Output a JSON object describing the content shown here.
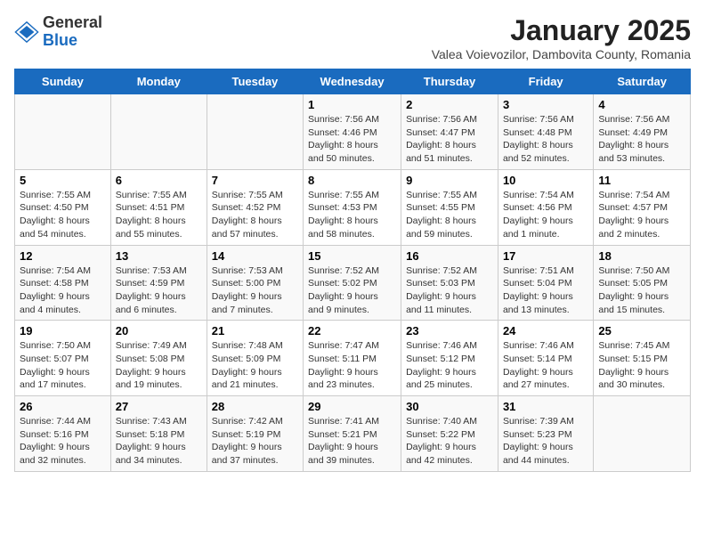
{
  "logo": {
    "general": "General",
    "blue": "Blue"
  },
  "header": {
    "title": "January 2025",
    "subtitle": "Valea Voievozilor, Dambovita County, Romania"
  },
  "weekdays": [
    "Sunday",
    "Monday",
    "Tuesday",
    "Wednesday",
    "Thursday",
    "Friday",
    "Saturday"
  ],
  "weeks": [
    [
      {
        "day": "",
        "info": ""
      },
      {
        "day": "",
        "info": ""
      },
      {
        "day": "",
        "info": ""
      },
      {
        "day": "1",
        "info": "Sunrise: 7:56 AM\nSunset: 4:46 PM\nDaylight: 8 hours\nand 50 minutes."
      },
      {
        "day": "2",
        "info": "Sunrise: 7:56 AM\nSunset: 4:47 PM\nDaylight: 8 hours\nand 51 minutes."
      },
      {
        "day": "3",
        "info": "Sunrise: 7:56 AM\nSunset: 4:48 PM\nDaylight: 8 hours\nand 52 minutes."
      },
      {
        "day": "4",
        "info": "Sunrise: 7:56 AM\nSunset: 4:49 PM\nDaylight: 8 hours\nand 53 minutes."
      }
    ],
    [
      {
        "day": "5",
        "info": "Sunrise: 7:55 AM\nSunset: 4:50 PM\nDaylight: 8 hours\nand 54 minutes."
      },
      {
        "day": "6",
        "info": "Sunrise: 7:55 AM\nSunset: 4:51 PM\nDaylight: 8 hours\nand 55 minutes."
      },
      {
        "day": "7",
        "info": "Sunrise: 7:55 AM\nSunset: 4:52 PM\nDaylight: 8 hours\nand 57 minutes."
      },
      {
        "day": "8",
        "info": "Sunrise: 7:55 AM\nSunset: 4:53 PM\nDaylight: 8 hours\nand 58 minutes."
      },
      {
        "day": "9",
        "info": "Sunrise: 7:55 AM\nSunset: 4:55 PM\nDaylight: 8 hours\nand 59 minutes."
      },
      {
        "day": "10",
        "info": "Sunrise: 7:54 AM\nSunset: 4:56 PM\nDaylight: 9 hours\nand 1 minute."
      },
      {
        "day": "11",
        "info": "Sunrise: 7:54 AM\nSunset: 4:57 PM\nDaylight: 9 hours\nand 2 minutes."
      }
    ],
    [
      {
        "day": "12",
        "info": "Sunrise: 7:54 AM\nSunset: 4:58 PM\nDaylight: 9 hours\nand 4 minutes."
      },
      {
        "day": "13",
        "info": "Sunrise: 7:53 AM\nSunset: 4:59 PM\nDaylight: 9 hours\nand 6 minutes."
      },
      {
        "day": "14",
        "info": "Sunrise: 7:53 AM\nSunset: 5:00 PM\nDaylight: 9 hours\nand 7 minutes."
      },
      {
        "day": "15",
        "info": "Sunrise: 7:52 AM\nSunset: 5:02 PM\nDaylight: 9 hours\nand 9 minutes."
      },
      {
        "day": "16",
        "info": "Sunrise: 7:52 AM\nSunset: 5:03 PM\nDaylight: 9 hours\nand 11 minutes."
      },
      {
        "day": "17",
        "info": "Sunrise: 7:51 AM\nSunset: 5:04 PM\nDaylight: 9 hours\nand 13 minutes."
      },
      {
        "day": "18",
        "info": "Sunrise: 7:50 AM\nSunset: 5:05 PM\nDaylight: 9 hours\nand 15 minutes."
      }
    ],
    [
      {
        "day": "19",
        "info": "Sunrise: 7:50 AM\nSunset: 5:07 PM\nDaylight: 9 hours\nand 17 minutes."
      },
      {
        "day": "20",
        "info": "Sunrise: 7:49 AM\nSunset: 5:08 PM\nDaylight: 9 hours\nand 19 minutes."
      },
      {
        "day": "21",
        "info": "Sunrise: 7:48 AM\nSunset: 5:09 PM\nDaylight: 9 hours\nand 21 minutes."
      },
      {
        "day": "22",
        "info": "Sunrise: 7:47 AM\nSunset: 5:11 PM\nDaylight: 9 hours\nand 23 minutes."
      },
      {
        "day": "23",
        "info": "Sunrise: 7:46 AM\nSunset: 5:12 PM\nDaylight: 9 hours\nand 25 minutes."
      },
      {
        "day": "24",
        "info": "Sunrise: 7:46 AM\nSunset: 5:14 PM\nDaylight: 9 hours\nand 27 minutes."
      },
      {
        "day": "25",
        "info": "Sunrise: 7:45 AM\nSunset: 5:15 PM\nDaylight: 9 hours\nand 30 minutes."
      }
    ],
    [
      {
        "day": "26",
        "info": "Sunrise: 7:44 AM\nSunset: 5:16 PM\nDaylight: 9 hours\nand 32 minutes."
      },
      {
        "day": "27",
        "info": "Sunrise: 7:43 AM\nSunset: 5:18 PM\nDaylight: 9 hours\nand 34 minutes."
      },
      {
        "day": "28",
        "info": "Sunrise: 7:42 AM\nSunset: 5:19 PM\nDaylight: 9 hours\nand 37 minutes."
      },
      {
        "day": "29",
        "info": "Sunrise: 7:41 AM\nSunset: 5:21 PM\nDaylight: 9 hours\nand 39 minutes."
      },
      {
        "day": "30",
        "info": "Sunrise: 7:40 AM\nSunset: 5:22 PM\nDaylight: 9 hours\nand 42 minutes."
      },
      {
        "day": "31",
        "info": "Sunrise: 7:39 AM\nSunset: 5:23 PM\nDaylight: 9 hours\nand 44 minutes."
      },
      {
        "day": "",
        "info": ""
      }
    ]
  ]
}
